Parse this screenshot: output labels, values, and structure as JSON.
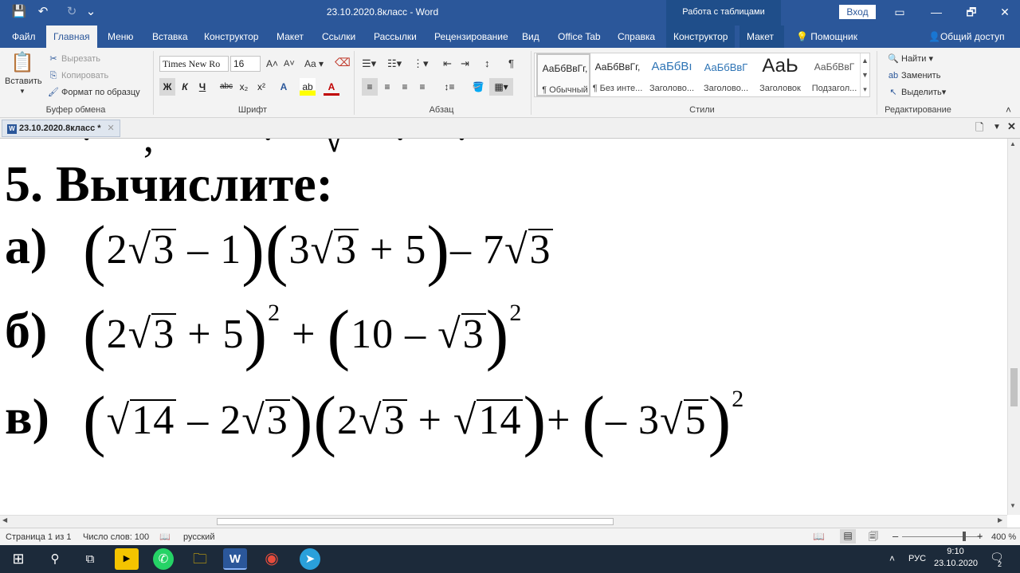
{
  "window": {
    "title": "23.10.2020.8класс  -  Word",
    "context_tools": "Работа с таблицами",
    "sign_in": "Вход",
    "quick_access": [
      "💾",
      "↶",
      "↻",
      "⌄"
    ],
    "controls": [
      "▭",
      "🗗",
      "✕"
    ]
  },
  "tabs": [
    {
      "label": "Файл"
    },
    {
      "label": "Главная"
    },
    {
      "label": "Меню"
    },
    {
      "label": "Вставка"
    },
    {
      "label": "Конструктор"
    },
    {
      "label": "Макет"
    },
    {
      "label": "Ссылки"
    },
    {
      "label": "Рассылки"
    },
    {
      "label": "Рецензирование"
    },
    {
      "label": "Вид"
    },
    {
      "label": "Office Tab"
    },
    {
      "label": "Справка"
    },
    {
      "label": "Конструктор"
    },
    {
      "label": "Макет"
    }
  ],
  "tell_me": "Помощник",
  "share": "Общий доступ",
  "ribbon": {
    "clipboard": {
      "paste": "Вставить",
      "cut": "Вырезать",
      "copy": "Копировать",
      "format_painter": "Формат по образцу",
      "group": "Буфер обмена"
    },
    "font": {
      "name": "Times New Ro",
      "size": "16",
      "group": "Шрифт",
      "bold": "Ж",
      "italic": "К",
      "underline": "Ч",
      "strike": "abc",
      "sub": "x₂",
      "sup": "x²"
    },
    "paragraph": {
      "group": "Абзац"
    },
    "styles": {
      "group": "Стили",
      "items": [
        {
          "preview": "АаБбВвГг,",
          "name": "¶ Обычный"
        },
        {
          "preview": "АаБбВвГг,",
          "name": "¶ Без инте..."
        },
        {
          "preview": "АаБбВı",
          "name": "Заголово..."
        },
        {
          "preview": "АаБбВвГ",
          "name": "Заголово..."
        },
        {
          "preview": "АаЬ",
          "name": "Заголовок"
        },
        {
          "preview": "АаБбВвГ",
          "name": "Подзагол..."
        }
      ]
    },
    "editing": {
      "find": "Найти",
      "replace": "Заменить",
      "select": "Выделить",
      "group": "Редактирование"
    }
  },
  "doc_tab": {
    "label": "23.10.2020.8класс *"
  },
  "document": {
    "heading": "5. Вычислите:",
    "items": [
      {
        "label": "а)"
      },
      {
        "label": "б)"
      },
      {
        "label": "в)"
      }
    ]
  },
  "status": {
    "page": "Страница 1 из 1",
    "words": "Число слов: 100",
    "language": "русский",
    "zoom": "400 %"
  },
  "taskbar": {
    "lang": "РУС",
    "time": "9:10",
    "date": "23.10.2020",
    "notif": "2"
  }
}
